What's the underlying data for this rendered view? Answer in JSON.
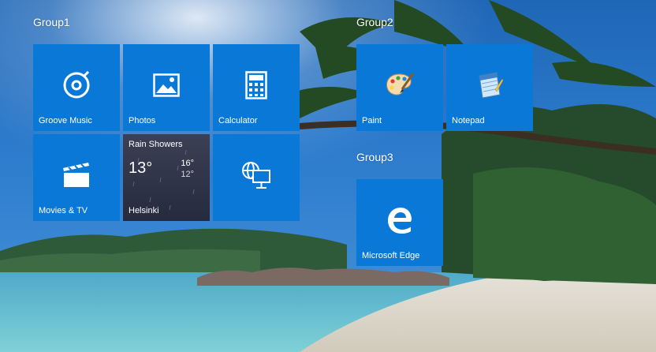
{
  "groups": [
    {
      "label": "Group1"
    },
    {
      "label": "Group2"
    },
    {
      "label": "Group3"
    }
  ],
  "tiles": {
    "groove": {
      "label": "Groove Music",
      "icon": "groove-music-icon"
    },
    "photos": {
      "label": "Photos",
      "icon": "photos-icon"
    },
    "calculator": {
      "label": "Calculator",
      "icon": "calculator-icon"
    },
    "movies": {
      "label": "Movies & TV",
      "icon": "movies-tv-icon"
    },
    "weather": {
      "condition": "Rain Showers",
      "temp": "13°",
      "high": "16°",
      "low": "12°",
      "location": "Helsinki"
    },
    "network": {
      "label": "",
      "icon": "network-globe-icon"
    },
    "paint": {
      "label": "Paint",
      "icon": "paint-palette-icon"
    },
    "notepad": {
      "label": "Notepad",
      "icon": "notepad-icon"
    },
    "edge": {
      "label": "Microsoft Edge",
      "icon": "edge-icon"
    }
  },
  "colors": {
    "tile": "#0a78d7",
    "weather_tile": "#2e3245"
  }
}
